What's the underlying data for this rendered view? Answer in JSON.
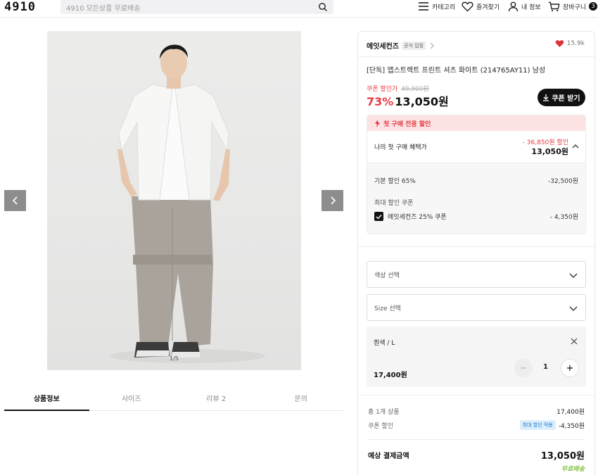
{
  "header": {
    "logo": "4910",
    "search_placeholder": "4910 모든상품 무료배송",
    "nav": [
      {
        "label": "카테고리",
        "icon": "menu-icon"
      },
      {
        "label": "즐겨찾기",
        "icon": "heart-outline-icon"
      },
      {
        "label": "내 정보",
        "icon": "user-icon"
      },
      {
        "label": "장바구니",
        "icon": "cart-icon",
        "count": "3"
      }
    ]
  },
  "gallery": {
    "counter": "1/5"
  },
  "tabs": [
    {
      "label": "상품정보",
      "active": true
    },
    {
      "label": "사이즈",
      "active": false
    },
    {
      "label": "리뷰 2",
      "active": false
    },
    {
      "label": "문의",
      "active": false
    }
  ],
  "product": {
    "brand": "에잇세컨즈",
    "brand_badge": "공식 입점",
    "likes": "15.9k",
    "title": "[단독] 앱스트렉트 프린트 셔츠 화이트 (214765AY11) 남성",
    "coupon_label": "쿠폰 할인가",
    "original_price": "49,900원",
    "discount_pct": "73%",
    "price": "13,050원",
    "coupon_button": "쿠폰 받기"
  },
  "first_purchase": {
    "header": "첫 구매 전용 할인",
    "benefit_label": "나의 첫 구매 혜택가",
    "benefit_discount": "- 36,850원 할인",
    "benefit_price": "13,050원",
    "base_label": "기본 할인 65%",
    "base_value": "-32,500원",
    "max_coupon_label": "최대 할인 쿠폰",
    "coupon_name": "에잇세컨즈 25% 쿠폰",
    "coupon_value": "- 4,350원"
  },
  "options": {
    "color_select": "색상 선택",
    "size_select": "Size 선택",
    "selected_name": "흰색 / L",
    "selected_price": "17,400원",
    "quantity": "1"
  },
  "summary": {
    "count_label": "총 1개 상품",
    "count_value": "17,400원",
    "coupon_label": "쿠폰 할인",
    "coupon_badge": "최대 할인 적용",
    "coupon_value": "-4,350원",
    "total_label": "예상 결제금액",
    "total_value": "13,050원",
    "shipping": "무료배송"
  },
  "colors": {
    "accent_red": "#ec3b45",
    "free_ship_green": "#8bc34a",
    "badge_blue": "#1e79c8"
  }
}
